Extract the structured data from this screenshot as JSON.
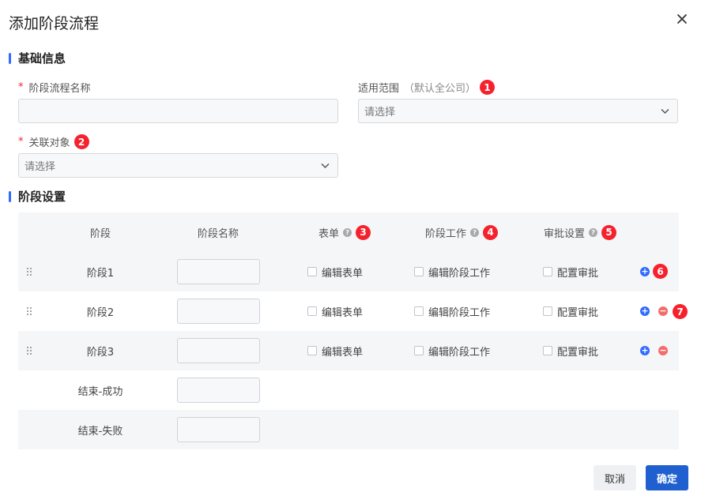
{
  "dialog": {
    "title": "添加阶段流程",
    "close_icon": "close-icon"
  },
  "basic": {
    "section_title": "基础信息",
    "name_label": "阶段流程名称",
    "name_required": "*",
    "name_value": "",
    "scope_label": "适用范围",
    "scope_hint": "（默认全公司）",
    "scope_badge": "1",
    "scope_placeholder": "请选择",
    "object_label": "关联对象",
    "object_required": "*",
    "object_badge": "2",
    "object_placeholder": "请选择"
  },
  "stages": {
    "section_title": "阶段设置",
    "headers": {
      "stage": "阶段",
      "name": "阶段名称",
      "form": "表单",
      "form_badge": "3",
      "work": "阶段工作",
      "work_badge": "4",
      "approval": "审批设置",
      "approval_badge": "5"
    },
    "rows": [
      {
        "stage": "阶段1",
        "form": "编辑表单",
        "work": "编辑阶段工作",
        "approval": "配置审批",
        "add_badge": "6"
      },
      {
        "stage": "阶段2",
        "form": "编辑表单",
        "work": "编辑阶段工作",
        "approval": "配置审批",
        "remove_badge": "7"
      },
      {
        "stage": "阶段3",
        "form": "编辑表单",
        "work": "编辑阶段工作",
        "approval": "配置审批"
      },
      {
        "stage": "结束-成功"
      },
      {
        "stage": "结束-失败"
      }
    ]
  },
  "footer": {
    "cancel": "取消",
    "confirm": "确定"
  },
  "colors": {
    "accent": "#2f6bff",
    "primary_button": "#1f5fcf",
    "badge": "#f5222d",
    "remove": "#f56c6c"
  }
}
